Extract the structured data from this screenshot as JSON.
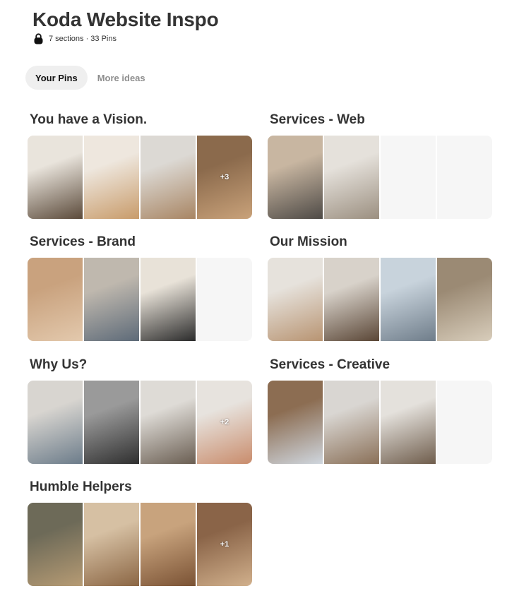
{
  "board": {
    "title": "Koda Website Inspo",
    "meta": "7 sections · 33 Pins"
  },
  "tabs": [
    {
      "label": "Your Pins",
      "active": true
    },
    {
      "label": "More ideas",
      "active": false
    }
  ],
  "sections": [
    {
      "title": "You have a Vision.",
      "tiles": [
        {
          "colors": [
            "#e9e4dc",
            "#5b4a3a"
          ],
          "overlay": ""
        },
        {
          "colors": [
            "#eee7de",
            "#c89b6a"
          ],
          "overlay": ""
        },
        {
          "colors": [
            "#dcd9d4",
            "#a88563"
          ],
          "overlay": ""
        },
        {
          "colors": [
            "#8b6a4c",
            "#c9a27a"
          ],
          "overlay": "+3"
        }
      ]
    },
    {
      "title": "Services - Web",
      "tiles": [
        {
          "colors": [
            "#c8b6a1",
            "#4e4a46"
          ],
          "overlay": ""
        },
        {
          "colors": [
            "#e5e1db",
            "#9b8f80"
          ],
          "overlay": ""
        },
        {
          "colors": [],
          "overlay": ""
        },
        {
          "colors": [],
          "overlay": ""
        }
      ]
    },
    {
      "title": "Services - Brand",
      "tiles": [
        {
          "colors": [
            "#c9a27e",
            "#e3c9ad"
          ],
          "overlay": ""
        },
        {
          "colors": [
            "#bfb8ae",
            "#5d6a78"
          ],
          "overlay": ""
        },
        {
          "colors": [
            "#e8e2d8",
            "#2b2b2b"
          ],
          "overlay": ""
        },
        {
          "colors": [],
          "overlay": ""
        }
      ]
    },
    {
      "title": "Our Mission",
      "tiles": [
        {
          "colors": [
            "#e6e2dc",
            "#b89472"
          ],
          "overlay": ""
        },
        {
          "colors": [
            "#d8d2ca",
            "#5a4636"
          ],
          "overlay": ""
        },
        {
          "colors": [
            "#c8d3dc",
            "#6f7d8a"
          ],
          "overlay": ""
        },
        {
          "colors": [
            "#9b8a74",
            "#d8cdbb"
          ],
          "overlay": ""
        }
      ]
    },
    {
      "title": "Why Us?",
      "tiles": [
        {
          "colors": [
            "#d8d5d0",
            "#6c7c8a"
          ],
          "overlay": ""
        },
        {
          "colors": [
            "#9a9a9a",
            "#2f2f2f"
          ],
          "overlay": ""
        },
        {
          "colors": [
            "#dedbd6",
            "#6a5e52"
          ],
          "overlay": ""
        },
        {
          "colors": [
            "#e7e3de",
            "#c98c6c"
          ],
          "overlay": "+2"
        }
      ]
    },
    {
      "title": "Services - Creative",
      "tiles": [
        {
          "colors": [
            "#8c6d52",
            "#cfd6de"
          ],
          "overlay": ""
        },
        {
          "colors": [
            "#d9d6d2",
            "#8a7058"
          ],
          "overlay": ""
        },
        {
          "colors": [
            "#e4e1dc",
            "#6f5d4c"
          ],
          "overlay": ""
        },
        {
          "colors": [],
          "overlay": ""
        }
      ]
    },
    {
      "title": "Humble Helpers",
      "tiles": [
        {
          "colors": [
            "#6d6a58",
            "#b69b74"
          ],
          "overlay": ""
        },
        {
          "colors": [
            "#d6c0a3",
            "#8b6644"
          ],
          "overlay": ""
        },
        {
          "colors": [
            "#c8a37d",
            "#7a5234"
          ],
          "overlay": ""
        },
        {
          "colors": [
            "#8a6448",
            "#d1b08c"
          ],
          "overlay": "+1"
        }
      ]
    }
  ]
}
